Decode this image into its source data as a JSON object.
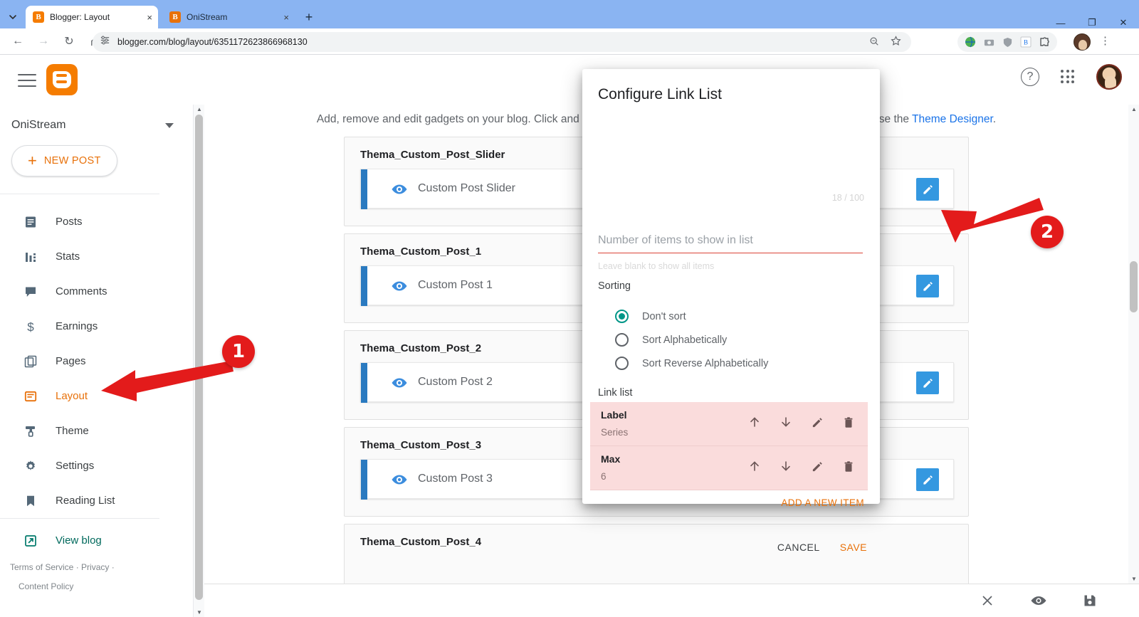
{
  "browser": {
    "tabs": [
      {
        "title": "Blogger: Layout",
        "favicon": "blogger-favicon",
        "active": true,
        "close": "×"
      },
      {
        "title": "OniStream",
        "favicon": "blogger-favicon",
        "active": false,
        "close": "×"
      }
    ],
    "new_tab_label": "+",
    "tab_list_icon": "chevron-down-icon",
    "window_controls": {
      "minimize": "—",
      "maximize": "❐",
      "close": "✕"
    },
    "nav": {
      "back": "←",
      "forward": "→",
      "reload": "↻",
      "home": "⌂"
    },
    "omnibox": {
      "url": "blogger.com/blog/layout/6351172623866968130",
      "site_settings_icon": "tune-icon",
      "zoom_icon": "zoom-search-icon",
      "bookmark_icon": "star-icon"
    },
    "extensions": [
      "globe-extension-icon",
      "camera-extension-icon",
      "shield-extension-icon",
      "blogger-extension-icon",
      "puzzle-extension-icon"
    ],
    "profile_icon": "chrome-profile-avatar",
    "menu_icon": "kebab-menu-icon"
  },
  "appbar": {
    "menu_icon": "hamburger-menu-icon",
    "logo": "blogger-logo",
    "help_icon": "help-circle-icon",
    "apps_icon": "apps-grid-icon",
    "avatar": "user-avatar"
  },
  "sidebar": {
    "blog_name": "OniStream",
    "switch_icon": "chevron-down-icon",
    "new_post_label": "NEW POST",
    "new_post_plus": "+",
    "items": [
      {
        "label": "Posts",
        "icon": "posts-icon",
        "active": false
      },
      {
        "label": "Stats",
        "icon": "stats-icon",
        "active": false
      },
      {
        "label": "Comments",
        "icon": "comments-icon",
        "active": false
      },
      {
        "label": "Earnings",
        "icon": "earnings-dollar-icon",
        "active": false
      },
      {
        "label": "Pages",
        "icon": "pages-icon",
        "active": false
      },
      {
        "label": "Layout",
        "icon": "layout-icon",
        "active": true
      },
      {
        "label": "Theme",
        "icon": "theme-brush-icon",
        "active": false
      },
      {
        "label": "Settings",
        "icon": "settings-gear-icon",
        "active": false
      },
      {
        "label": "Reading List",
        "icon": "reading-list-bookmark-icon",
        "active": false
      }
    ],
    "view_blog": {
      "label": "View blog",
      "icon": "open-in-new-icon"
    },
    "footer": {
      "terms": "Terms of Service",
      "sep1": "·",
      "privacy": "Privacy",
      "sep2": "·",
      "content_policy": "Content Policy"
    }
  },
  "main": {
    "hint_before": "Add, remove and edit gadgets on your blog. Click and drag to rearrange gadgets. To change columns and widths, use the ",
    "hint_link": "Theme Designer",
    "hint_after": ".",
    "gadgets": [
      {
        "section": "Thema_Custom_Post_Slider",
        "widget": "Custom Post Slider",
        "eye_icon": "eye-icon",
        "edit_icon": "pencil-edit-icon"
      },
      {
        "section": "Thema_Custom_Post_1",
        "widget": "Custom Post 1",
        "eye_icon": "eye-icon",
        "edit_icon": "pencil-edit-icon"
      },
      {
        "section": "Thema_Custom_Post_2",
        "widget": "Custom Post 2",
        "eye_icon": "eye-icon",
        "edit_icon": "pencil-edit-icon"
      },
      {
        "section": "Thema_Custom_Post_3",
        "widget": "Custom Post 3",
        "eye_icon": "eye-icon",
        "edit_icon": "pencil-edit-icon"
      },
      {
        "section": "Thema_Custom_Post_4",
        "widget": "",
        "eye_icon": "eye-icon",
        "edit_icon": "pencil-edit-icon"
      }
    ]
  },
  "bottom_bar": {
    "close_icon": "close-x-icon",
    "preview_icon": "eye-preview-icon",
    "save_icon": "save-disk-icon"
  },
  "dialog": {
    "title": "Configure Link List",
    "counter": "18 / 100",
    "number_input": {
      "value": "",
      "placeholder": "Number of items to show in list"
    },
    "helper_text": "Leave blank to show all items",
    "sorting_label": "Sorting",
    "sorting_options": [
      {
        "label": "Don't sort",
        "selected": true
      },
      {
        "label": "Sort Alphabetically",
        "selected": false
      },
      {
        "label": "Sort Reverse Alphabetically",
        "selected": false
      }
    ],
    "link_list_label": "Link list",
    "link_items": [
      {
        "label": "Label",
        "value": "Series",
        "up_icon": "arrow-up-icon",
        "down_icon": "arrow-down-icon",
        "edit_icon": "pencil-edit-icon",
        "delete_icon": "trash-delete-icon"
      },
      {
        "label": "Max",
        "value": "6",
        "up_icon": "arrow-up-icon",
        "down_icon": "arrow-down-icon",
        "edit_icon": "pencil-edit-icon",
        "delete_icon": "trash-delete-icon"
      }
    ],
    "add_item_label": "ADD A NEW ITEM",
    "cancel_label": "CANCEL",
    "save_label": "SAVE"
  },
  "annotations": [
    {
      "number": "1",
      "target": "sidebar-item-layout"
    },
    {
      "number": "2",
      "target": "gadget-edit-button"
    }
  ],
  "colors": {
    "accent_orange": "#e8710a",
    "link_blue": "#1a73e8",
    "radio_teal": "#009688",
    "annotation_red": "#e31b1b",
    "edit_button_blue": "#3498e0",
    "error_underline": "#db4437"
  }
}
